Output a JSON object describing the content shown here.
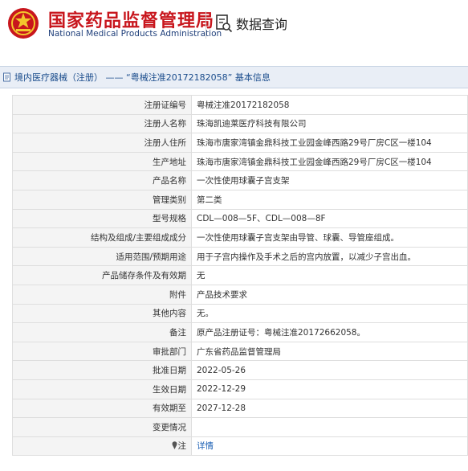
{
  "header": {
    "title_cn": "国家药品监督管理局",
    "title_en": "National Medical Products Administration",
    "query_label": "数据查询",
    "emblem_icon": "national-emblem-icon",
    "query_icon": "document-search-icon"
  },
  "breadcrumb": {
    "text": "境内医疗器械（注册） —— “粤械注准20172182058” 基本信息"
  },
  "rows": [
    {
      "label": "注册证编号",
      "value": "粤械注准20172182058"
    },
    {
      "label": "注册人名称",
      "value": "珠海凯迪莱医疗科技有限公司"
    },
    {
      "label": "注册人住所",
      "value": "珠海市唐家湾镇金鼎科技工业园金峰西路29号厂房C区一楼104"
    },
    {
      "label": "生产地址",
      "value": "珠海市唐家湾镇金鼎科技工业园金峰西路29号厂房C区一楼104"
    },
    {
      "label": "产品名称",
      "value": "一次性使用球囊子宫支架"
    },
    {
      "label": "管理类别",
      "value": "第二类"
    },
    {
      "label": "型号规格",
      "value": "CDL—008—5F、CDL—008—8F"
    },
    {
      "label": "结构及组成/主要组成成分",
      "value": "一次性使用球囊子宫支架由导管、球囊、导管座组成。"
    },
    {
      "label": "适用范围/预期用途",
      "value": "用于子宫内操作及手术之后的宫内放置，以减少子宫出血。"
    },
    {
      "label": "产品储存条件及有效期",
      "value": "无"
    },
    {
      "label": "附件",
      "value": "产品技术要求"
    },
    {
      "label": "其他内容",
      "value": "无。"
    },
    {
      "label": "备注",
      "value": "原产品注册证号：粤械注准20172662058。"
    },
    {
      "label": "审批部门",
      "value": "广东省药品监督管理局"
    },
    {
      "label": "批准日期",
      "value": "2022-05-26"
    },
    {
      "label": "生效日期",
      "value": "2022-12-29"
    },
    {
      "label": "有效期至",
      "value": "2027-12-28"
    },
    {
      "label": "变更情况",
      "value": ""
    },
    {
      "label": "注",
      "value": "详情",
      "link": true,
      "icon": "pin-icon"
    }
  ]
}
